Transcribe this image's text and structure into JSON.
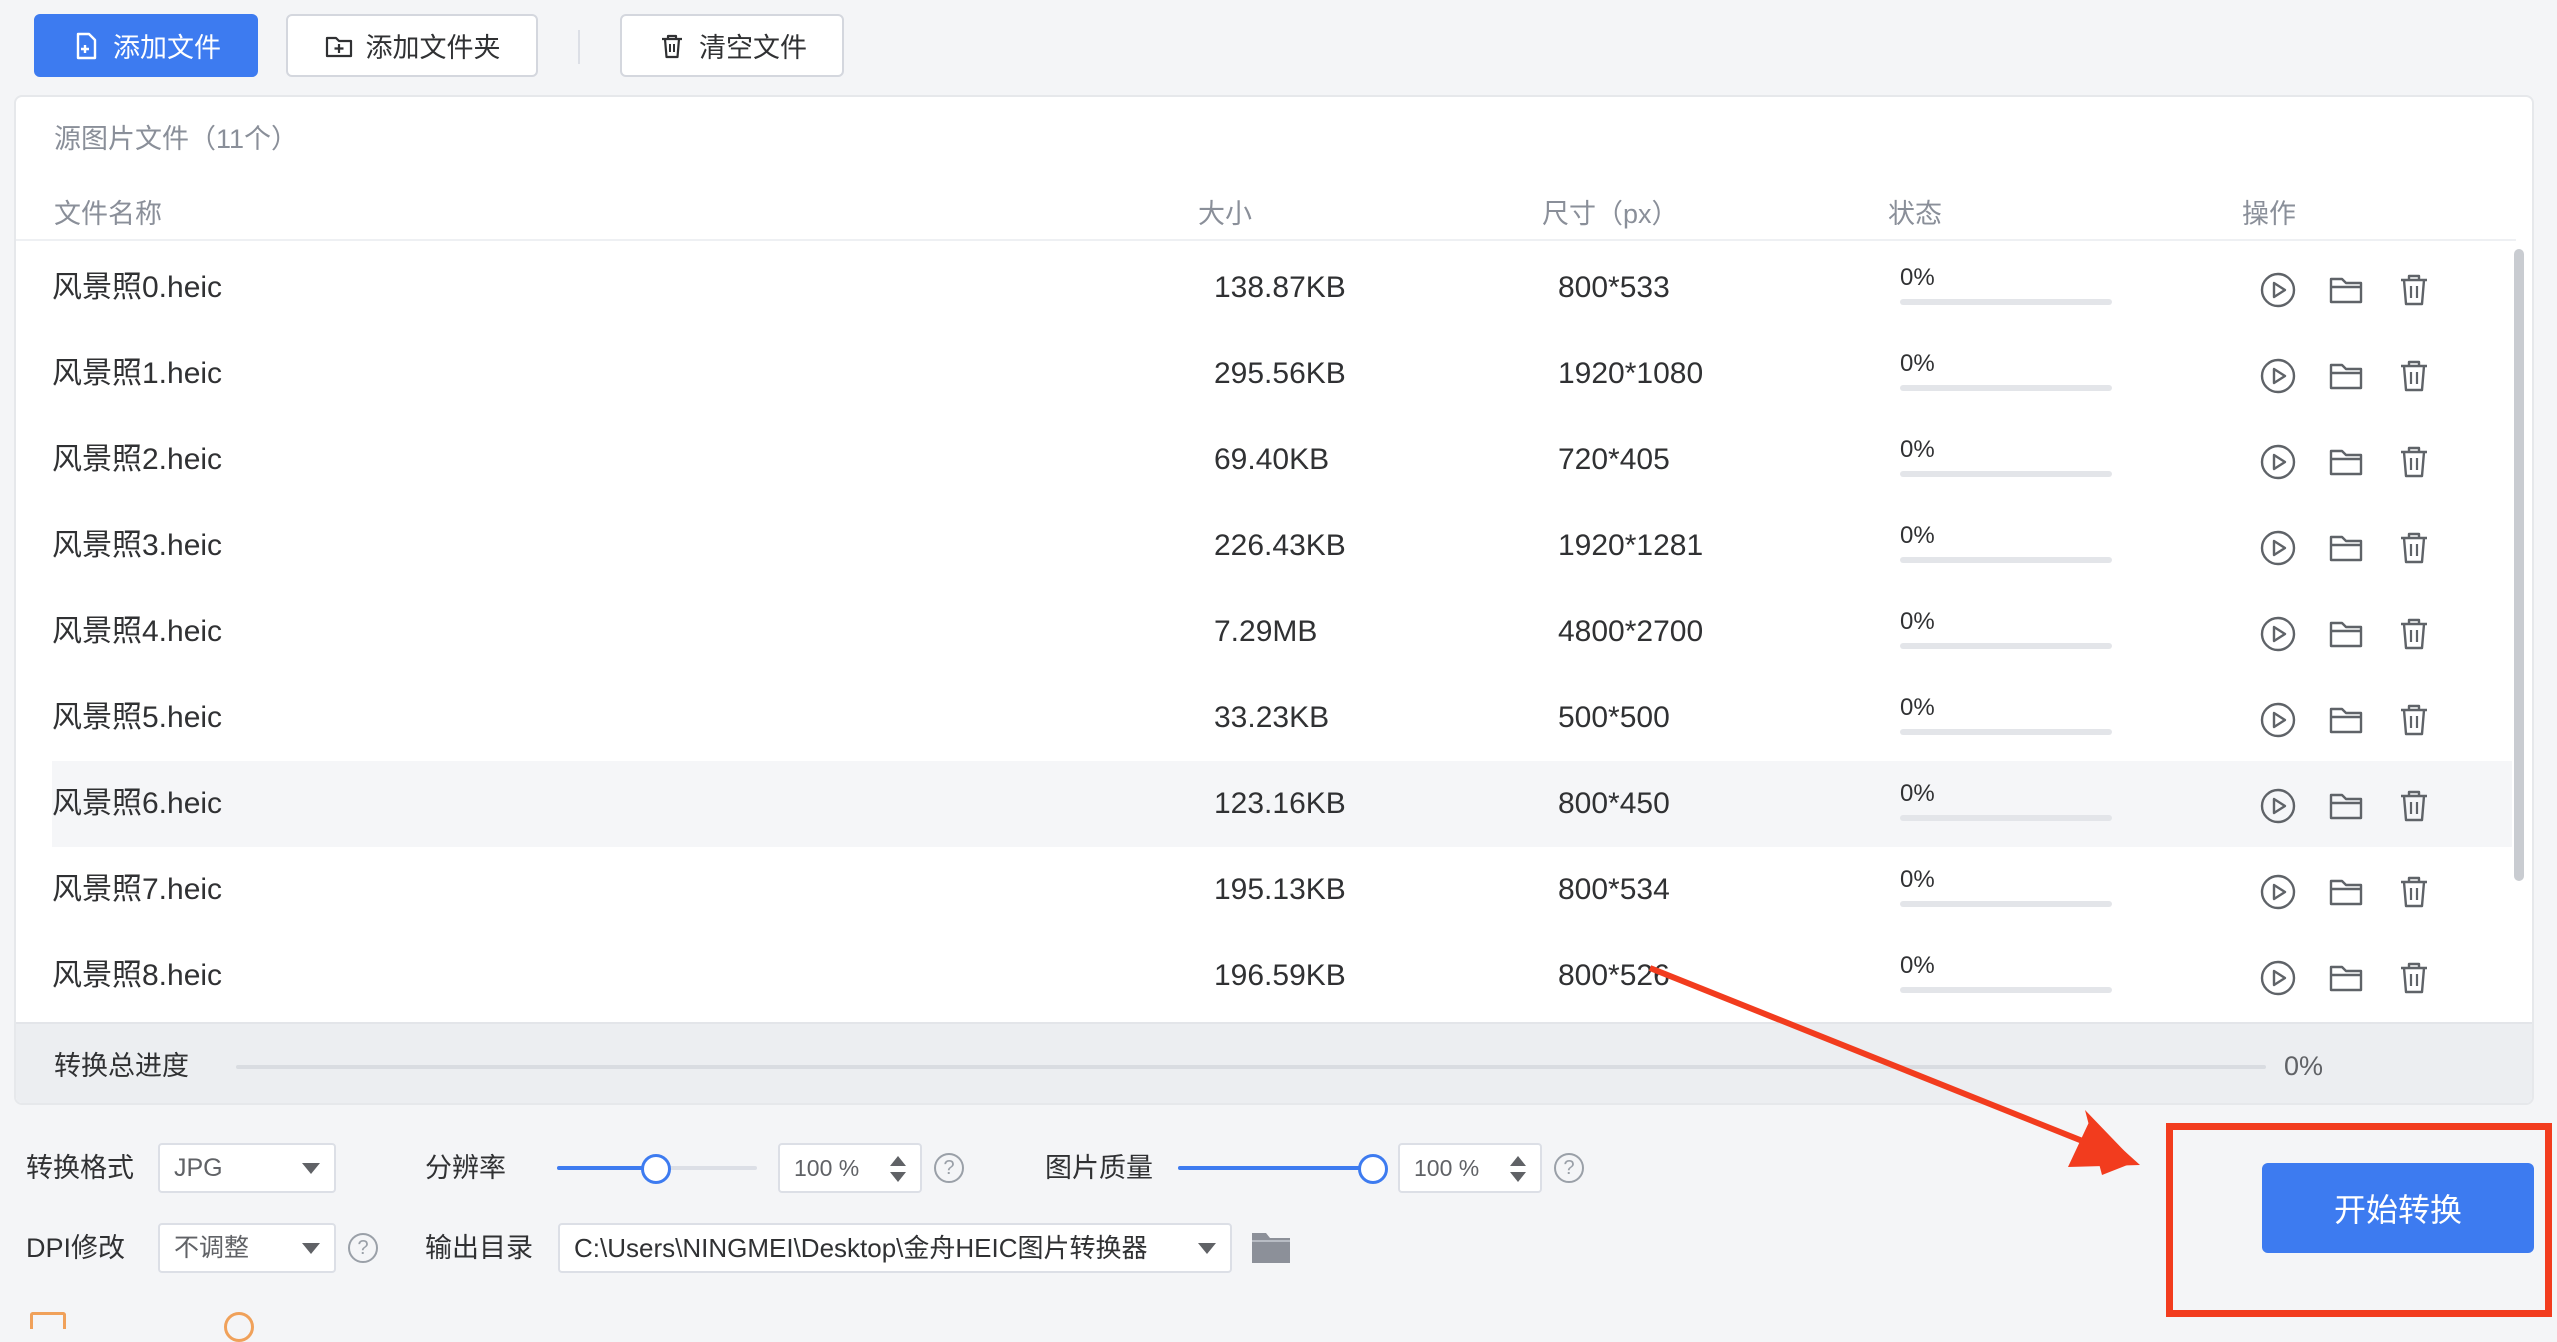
{
  "toolbar": {
    "add_file": "添加文件",
    "add_folder": "添加文件夹",
    "clear_files": "清空文件"
  },
  "panel": {
    "title": "源图片文件（11个）",
    "columns": {
      "name": "文件名称",
      "size": "大小",
      "dimensions": "尺寸（px）",
      "status": "状态",
      "actions": "操作"
    },
    "rows": [
      {
        "name": "风景照0.heic",
        "size": "138.87KB",
        "dims": "800*533",
        "status": "0%",
        "progress": 0
      },
      {
        "name": "风景照1.heic",
        "size": "295.56KB",
        "dims": "1920*1080",
        "status": "0%",
        "progress": 0
      },
      {
        "name": "风景照2.heic",
        "size": "69.40KB",
        "dims": "720*405",
        "status": "0%",
        "progress": 0
      },
      {
        "name": "风景照3.heic",
        "size": "226.43KB",
        "dims": "1920*1281",
        "status": "0%",
        "progress": 0
      },
      {
        "name": "风景照4.heic",
        "size": "7.29MB",
        "dims": "4800*2700",
        "status": "0%",
        "progress": 0
      },
      {
        "name": "风景照5.heic",
        "size": "33.23KB",
        "dims": "500*500",
        "status": "0%",
        "progress": 0
      },
      {
        "name": "风景照6.heic",
        "size": "123.16KB",
        "dims": "800*450",
        "status": "0%",
        "progress": 0
      },
      {
        "name": "风景照7.heic",
        "size": "195.13KB",
        "dims": "800*534",
        "status": "0%",
        "progress": 0
      },
      {
        "name": "风景照8.heic",
        "size": "196.59KB",
        "dims": "800*526",
        "status": "0%",
        "progress": 0
      }
    ],
    "total_label": "转换总进度",
    "total_pct": "0%",
    "total_progress": 0
  },
  "settings": {
    "format_label": "转换格式",
    "format_value": "JPG",
    "resolution_label": "分辨率",
    "resolution_value": "100 %",
    "resolution_level": 1.0,
    "quality_label": "图片质量",
    "quality_value": "100 %",
    "quality_level": 1.0,
    "dpi_label": "DPI修改",
    "dpi_value": "不调整",
    "output_label": "输出目录",
    "output_path": "C:\\Users\\NINGMEI\\Desktop\\金舟HEIC图片转换器",
    "help_glyph": "?"
  },
  "start_button": "开始转换",
  "colors": {
    "accent": "#3d7bf0",
    "annotation": "#f23c1e"
  }
}
